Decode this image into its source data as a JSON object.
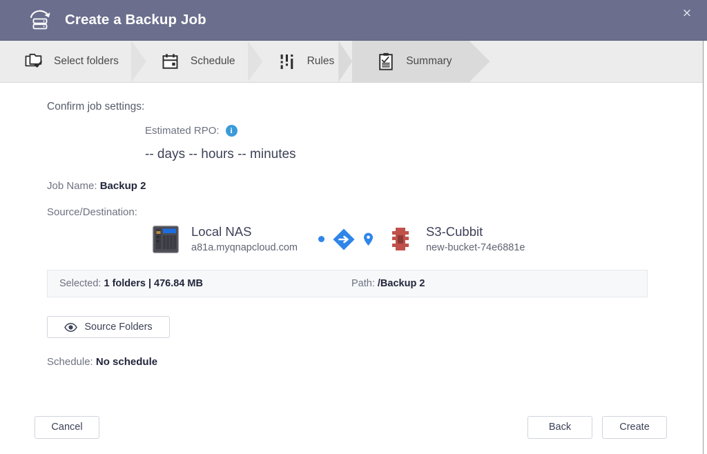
{
  "window": {
    "title": "Create a Backup Job",
    "title_icon": "backup-restore-icon",
    "close_label": "×",
    "header_color": "#6b6f8d"
  },
  "steps": [
    {
      "label": "Select folders",
      "icon": "folders-check-icon",
      "active": false
    },
    {
      "label": "Schedule",
      "icon": "calendar-icon",
      "active": false
    },
    {
      "label": "Rules",
      "icon": "sliders-icon",
      "active": false
    },
    {
      "label": "Summary",
      "icon": "clipboard-check-icon",
      "active": true
    }
  ],
  "summary": {
    "confirm_label": "Confirm job settings:",
    "rpo_label": "Estimated RPO:",
    "rpo_info_icon": "info-icon",
    "rpo_value": "-- days -- hours -- minutes",
    "job_name_label": "Job Name:",
    "job_name_value": "Backup 2",
    "source_destination_label": "Source/Destination:",
    "source": {
      "icon": "nas-device-icon",
      "name": "Local NAS",
      "address": "a81a.myqnapcloud.com"
    },
    "transfer": {
      "dot_icon": "transfer-dot-icon",
      "arrow_icon": "arrow-right-diamond-icon",
      "pin_icon": "location-pin-icon",
      "accent_color": "#2f86e8"
    },
    "destination": {
      "icon": "s3-bucket-icon",
      "name": "S3-Cubbit",
      "bucket": "new-bucket-74e6881e",
      "accent_color": "#c0514a"
    },
    "infobar": {
      "selected_label": "Selected:",
      "selected_value": "1 folders | 476.84 MB",
      "path_label": "Path:",
      "path_value": "/Backup 2"
    },
    "source_folders_button": {
      "label": "Source Folders",
      "icon": "eye-icon"
    },
    "schedule_label": "Schedule:",
    "schedule_value": "No schedule"
  },
  "footer": {
    "cancel_label": "Cancel",
    "back_label": "Back",
    "create_label": "Create"
  }
}
